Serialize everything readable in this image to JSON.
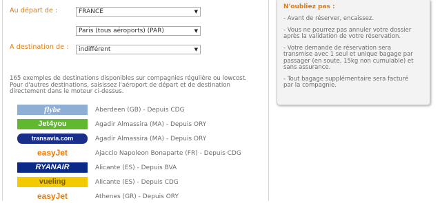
{
  "form": {
    "departure_label": "Au départ de :",
    "country_value": "FRANCE",
    "airport_value": "Paris (tous aéroports) (PAR)",
    "destination_label": "A destination de :",
    "destination_value": "indifférent"
  },
  "intro": {
    "lines": [
      "165 exemples de destinations disponibles sur compagnies régulière ou lowcost.",
      "Pour d'autres destinations, saisissez l'aéroport de départ et de destination",
      "directement dans le moteur ci-dessus."
    ]
  },
  "destinations": [
    {
      "airline": "flybe",
      "text": "Aberdeen (GB) - Depuis CDG"
    },
    {
      "airline": "Jet4you",
      "text": "Agadir Almassira (MA) - Depuis ORY"
    },
    {
      "airline": "transavia.com",
      "text": "Agadir Almassira (MA) - Depuis ORY"
    },
    {
      "airline": "easyJet",
      "text": "Ajaccio Napoleon Bonaparte (FR) - Depuis CDG"
    },
    {
      "airline": "RYANAIR",
      "text": "Alicante (ES) - Depuis BVA"
    },
    {
      "airline": "vueling",
      "text": "Alicante (ES) - Depuis CDG"
    },
    {
      "airline": "easyJet",
      "text": "Athenes (GR) - Depuis ORY"
    }
  ],
  "notice": {
    "title": "N'oubliez pas :",
    "items": [
      [
        "- Avant de réserver, encaissez."
      ],
      [
        "- Vous ne pourrez pas annuler votre dossier",
        "après la validation de votre réservation."
      ],
      [
        "- Votre demande de réservation sera",
        "transmise avec 1 seul et unique bagage par",
        "passager (en soute, 15kg non cumulable) et",
        "sans assurance."
      ],
      [
        "- Tout bagage supplémentaire sera facturé",
        "par la compagnie."
      ]
    ]
  },
  "colors": {
    "accent": "#e07a10",
    "flybe_bg": "#8eaed6",
    "jet4you_bg": "#5fb82e",
    "transavia_bg": "#1a2f8a",
    "easyjet_bg": "#f07a00",
    "ryanair_bg": "#0b2a88",
    "vueling_bg": "#f3ca00"
  },
  "icons": {
    "dropdown": "chevron-down-icon"
  }
}
